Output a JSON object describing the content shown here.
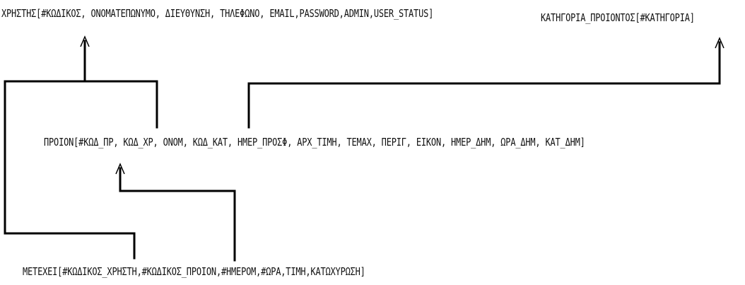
{
  "entities": {
    "xristis": "ΧΡΗΣΤΗΣ[#ΚΩΔΙΚΟΣ, ΟΝΟΜΑΤΕΠΩΝΥΜΟ, ΔΙΕΥΘΥΝΣΗ, ΤΗΛΕΦΩΝΟ, EMAIL,PASSWORD,ADMIN,USER_STATUS]",
    "katigoria": "ΚΑΤΗΓΟΡΙΑ_ΠΡΟΙΟΝΤΟΣ[#ΚΑΤΗΓΟΡΙΑ]",
    "proion": "ΠΡΟΙΟΝ[#ΚΩΔ_ΠΡ, ΚΩΔ_ΧΡ, ΟΝΟΜ, ΚΩΔ_ΚΑΤ, ΗΜΕΡ_ΠΡΟΣΦ, ΑΡΧ_ΤΙΜΗ, ΤΕΜΑΧ, ΠΕΡΙΓ, ΕΙΚΟΝ, ΗΜΕΡ_ΔΗΜ, ΩΡΑ_ΔΗΜ,  ΚΑΤ_ΔΗΜ]",
    "metexei": "ΜΕΤΕΧΕΙ[#ΚΩΔΙΚΟΣ_ΧΡΗΣΤΗ,#ΚΩΔΙΚΟΣ_ΠΡΟΙΟΝ,#ΗΜΕΡΟΜ,#ΩΡΑ,ΤΙΜΗ,ΚΑΤΩΧΥΡΩΣΗ]"
  },
  "colors": {
    "line": "#000000",
    "text": "#111111",
    "background": "#ffffff"
  }
}
